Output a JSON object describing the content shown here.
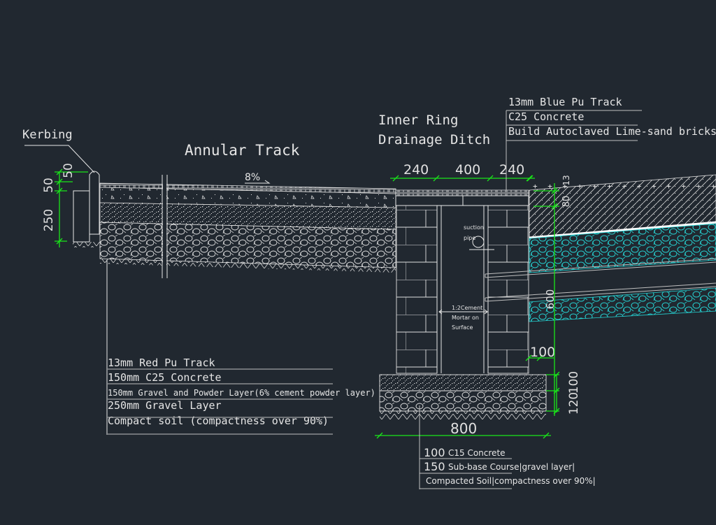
{
  "drawing": {
    "background": "#212830",
    "line_color": "#e8e8e8",
    "dimension_color": "#19e619",
    "hatch_gravel_color": "#25d6d6",
    "titles": {
      "kerbing": "Kerbing",
      "annular_track": "Annular Track",
      "drainage_line1": "Inner Ring",
      "drainage_line2": "Drainage Ditch"
    },
    "slope": "8%",
    "kerb_dimensions": [
      "50",
      "50",
      "250"
    ],
    "ditch_top_dimensions": [
      "240",
      "400",
      "240"
    ],
    "right_dimensions": {
      "surface": "13",
      "concrete": "80",
      "depth": "600",
      "wall_offset": "100"
    },
    "base_dimensions": {
      "width": "800",
      "concrete": "100",
      "subbase": "120"
    },
    "inner_labels": {
      "suction_pipe_1": "suction",
      "suction_pipe_2": "pipe",
      "mortar_1": "1:2Cement",
      "mortar_2": "Mortar on",
      "mortar_3": "Surface"
    },
    "right_legend": [
      "13mm Blue Pu Track",
      "C25 Concrete",
      "Build Autoclaved Lime-sand bricks"
    ],
    "left_legend": [
      "13mm Red Pu Track",
      "150mm C25 Concrete",
      "150mm Gravel and Powder Layer(6% cement powder layer)",
      "250mm Gravel Layer",
      "Compact soil (compactness over 90%)"
    ],
    "base_legend": [
      {
        "num": "100",
        "text": "C15 Concrete"
      },
      {
        "num": "150",
        "text": "Sub-base Course|gravel layer|"
      },
      {
        "num": "",
        "text": "Compacted Soil|compactness over 90%|"
      }
    ]
  }
}
